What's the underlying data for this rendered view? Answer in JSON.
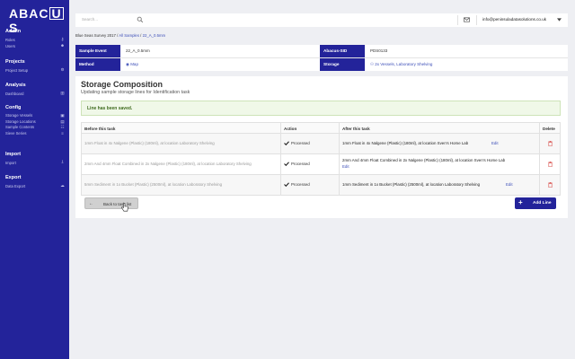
{
  "app": {
    "logo_pre": "ABAC",
    "logo_mid": "U",
    "logo_post": "S"
  },
  "sidebar": {
    "sections": [
      {
        "title": "Admin",
        "items": [
          {
            "label": "Roles",
            "icon": "key-icon"
          },
          {
            "label": "Users",
            "icon": "users-icon"
          }
        ]
      },
      {
        "title": "Projects",
        "items": [
          {
            "label": "Project Setup",
            "icon": "gear-icon"
          }
        ]
      },
      {
        "title": "Analysis",
        "items": [
          {
            "label": "Dashboard",
            "icon": "chart-icon"
          }
        ]
      },
      {
        "title": "Config",
        "items": [
          {
            "label": "Storage Vessels",
            "icon": "box-icon"
          },
          {
            "label": "Storage Locations",
            "icon": "location-icon"
          },
          {
            "label": "Sample Contents",
            "icon": "contents-icon"
          },
          {
            "label": "Sieve Series",
            "icon": "sieve-icon"
          }
        ]
      },
      {
        "title": "Import",
        "items": [
          {
            "label": "Import",
            "icon": "import-icon"
          }
        ]
      },
      {
        "title": "Export",
        "items": [
          {
            "label": "Data Export",
            "icon": "export-icon"
          }
        ]
      }
    ]
  },
  "topbar": {
    "search_placeholder": "Search...",
    "email": "info@peninsuladatasolutions.co.uk"
  },
  "breadcrumb": {
    "root": "Blue Seas Survey 2017",
    "sep1": " / ",
    "all_samples": "All Samples",
    "sep2": " / ",
    "current": "22_A_0.5mm"
  },
  "info": {
    "sample_event_label": "Sample Event",
    "sample_event_value": "22_A_0.5mm",
    "method_label": "Method",
    "method_value": "Map",
    "sid_label": "Abacus-SID",
    "sid_value": "PDS0133",
    "storage_label": "Storage",
    "storage_value": "2x Vessels, Laboratory Shelving"
  },
  "card": {
    "title": "Storage Composition",
    "subtitle": "Updating sample storage lines for Identification task",
    "alert": "Line has been saved."
  },
  "table": {
    "headers": {
      "before": "Before this task",
      "action": "Action",
      "after": "After this task",
      "delete": "Delete"
    },
    "rows": [
      {
        "before": "1mm Float in 4x Nalgene (Plastic) (180ml), at location Laboratory Shelving",
        "action": "Processed",
        "after": "1mm Float in 4x Nalgene (Plastic) (180ml), at location Sven's Home Lab",
        "edit": "Edit"
      },
      {
        "before": "2mm And 4mm Float Combined in 2x Nalgene (Plastic) (180ml), at location Laboratory Shelving",
        "action": "Processed",
        "after": "2mm And 4mm Float Combined in 2x Nalgene (Plastic) (180ml), at location Sven's Home Lab",
        "edit": "Edit"
      },
      {
        "before": "5mm Sediment in 1x Bucket (Plastic) (2500ml), at location Laboratory Shelving",
        "action": "Processed",
        "after": "1mm Sediment in 1x Bucket (Plastic) (2500ml), at location Laboratory Shelving",
        "edit": "Edit"
      }
    ]
  },
  "buttons": {
    "back": "Back to task list",
    "add": "Add Line"
  },
  "colors": {
    "brand": "#23239a",
    "link": "#3d4fb8",
    "delete": "#d9534f",
    "success_text": "#3f6b1f"
  }
}
